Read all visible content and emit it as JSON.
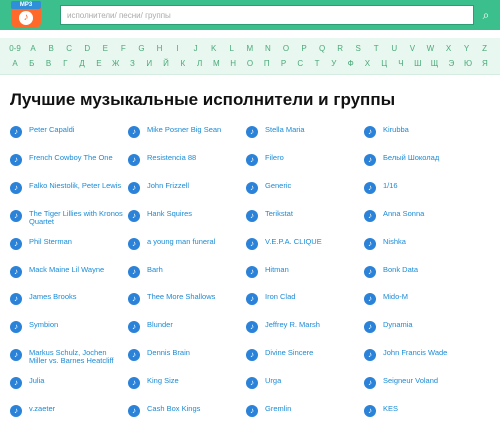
{
  "header": {
    "logo_badge": "MP3",
    "search_placeholder": "исполнители/ песни/ группы"
  },
  "alphabet": {
    "latin": [
      "0-9",
      "A",
      "B",
      "C",
      "D",
      "E",
      "F",
      "G",
      "H",
      "I",
      "J",
      "K",
      "L",
      "M",
      "N",
      "O",
      "P",
      "Q",
      "R",
      "S",
      "T",
      "U",
      "V",
      "W",
      "X",
      "Y",
      "Z"
    ],
    "cyrillic": [
      "А",
      "Б",
      "В",
      "Г",
      "Д",
      "Е",
      "Ж",
      "З",
      "И",
      "Й",
      "К",
      "Л",
      "М",
      "Н",
      "О",
      "П",
      "Р",
      "С",
      "Т",
      "У",
      "Ф",
      "Х",
      "Ц",
      "Ч",
      "Ш",
      "Щ",
      "Э",
      "Ю",
      "Я"
    ]
  },
  "page_title": "Лучшие музыкальные исполнители и группы",
  "artists": [
    [
      "Peter Capaldi",
      "Mike Posner Big Sean",
      "Stella Maria",
      "Kirubba"
    ],
    [
      "French Cowboy The One",
      "Resistencia 88",
      "Filero",
      "Белый Шоколад"
    ],
    [
      "Falko Niestolik, Peter Lewis",
      "John Frizzell",
      "Generic",
      "1/16"
    ],
    [
      "The Tiger Lillies with Kronos Quartet",
      "Hank Squires",
      "Terikstat",
      "Anna Sonna"
    ],
    [
      "Phil Sterman",
      "a young man funeral",
      "V.E.P.A. CLIQUE",
      "Nishka"
    ],
    [
      "Mack Maine Lil Wayne",
      "Barh",
      "Hitman",
      "Bonk Data"
    ],
    [
      "James Brooks",
      "Thee More Shallows",
      "Iron Clad",
      "Mido-M"
    ],
    [
      "Symbion",
      "Blunder",
      "Jeffrey R. Marsh",
      "Dynamia"
    ],
    [
      "Markus Schulz, Jochen Miller vs. Barnes Heatcliff",
      "Dennis Brain",
      "Divine Sincere",
      "John Francis Wade"
    ],
    [
      "Julia",
      "King Size",
      "Urga",
      "Seigneur Voland"
    ],
    [
      "v.zaeter",
      "Cash Box Kings",
      "Gremlin",
      "KES"
    ]
  ]
}
